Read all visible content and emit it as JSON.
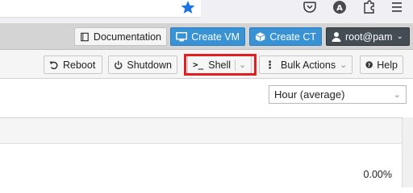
{
  "browser": {
    "bookmark_icon": "star-icon",
    "icons": [
      "pocket-icon",
      "account-icon",
      "extensions-icon",
      "menu-icon"
    ]
  },
  "header": {
    "documentation": "Documentation",
    "create_vm": "Create VM",
    "create_ct": "Create CT",
    "user": "root@pam"
  },
  "toolbar": {
    "reboot": "Reboot",
    "shutdown": "Shutdown",
    "shell": "Shell",
    "bulk_actions": "Bulk Actions",
    "help": "Help"
  },
  "timeframe": {
    "selected": "Hour (average)"
  },
  "stats": {
    "cpu_percent": "0.00%"
  },
  "colors": {
    "accent": "#3892d4",
    "highlight": "#e02020",
    "user_button": "#444c54"
  }
}
